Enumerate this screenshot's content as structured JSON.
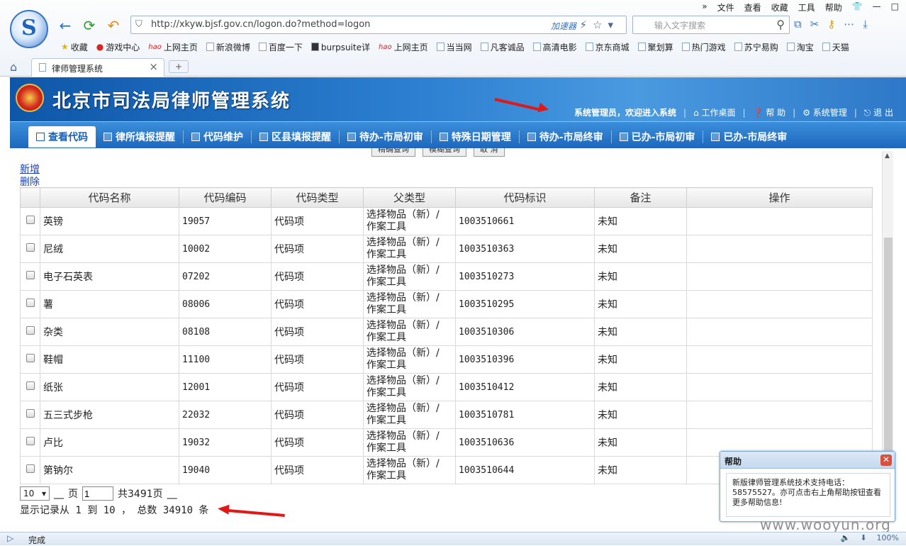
{
  "browser": {
    "menu": [
      "»",
      "文件",
      "查看",
      "收藏",
      "工具",
      "帮助"
    ],
    "url": "http://xkyw.bjsf.gov.cn/logon.do?method=logon",
    "accelerator": "加速器",
    "search_placeholder": "输入文字搜索",
    "bookmarks": [
      "收藏",
      "游戏中心",
      "上网主页",
      "新浪微博",
      "百度一下",
      "burpsuite详",
      "上网主页",
      "当当网",
      "凡客诚品",
      "高清电影",
      "京东商城",
      "聚划算",
      "热门游戏",
      "苏宁易购",
      "淘宝",
      "天猫"
    ],
    "tab_title": "律师管理系统",
    "status_text": "完成",
    "zoom": "100%"
  },
  "app": {
    "title": "北京市司法局律师管理系统",
    "welcome": "系统管理员，欢迎进入系统",
    "top_links": [
      "工作桌面",
      "帮 助",
      "系统管理",
      "退 出"
    ],
    "nav": [
      "查看代码",
      "律所填报提醒",
      "代码维护",
      "区县填报提醒",
      "待办-市局初审",
      "特殊日期管理",
      "待办-市局终审",
      "已办-市局初审",
      "已办-市局终审"
    ],
    "top_buttons": [
      "精确查询",
      "模糊查询",
      "取 消"
    ],
    "add_link": "新增",
    "delete_link": "删除",
    "columns": [
      "代码名称",
      "代码编码",
      "代码类型",
      "父类型",
      "代码标识",
      "备注",
      "操作"
    ],
    "rows": [
      {
        "name": "英镑",
        "code": "19057",
        "type": "代码项",
        "parent1": "选择物品（新）/",
        "parent2": "作案工具",
        "id": "1003510661",
        "note": "未知"
      },
      {
        "name": "尼绒",
        "code": "10002",
        "type": "代码项",
        "parent1": "选择物品（新）/",
        "parent2": "作案工具",
        "id": "1003510363",
        "note": "未知"
      },
      {
        "name": "电子石英表",
        "code": "07202",
        "type": "代码项",
        "parent1": "选择物品（新）/",
        "parent2": "作案工具",
        "id": "1003510273",
        "note": "未知"
      },
      {
        "name": "薯",
        "code": "08006",
        "type": "代码项",
        "parent1": "选择物品（新）/",
        "parent2": "作案工具",
        "id": "1003510295",
        "note": "未知"
      },
      {
        "name": "杂类",
        "code": "08108",
        "type": "代码项",
        "parent1": "选择物品（新）/",
        "parent2": "作案工具",
        "id": "1003510306",
        "note": "未知"
      },
      {
        "name": "鞋帽",
        "code": "11100",
        "type": "代码项",
        "parent1": "选择物品（新）/",
        "parent2": "作案工具",
        "id": "1003510396",
        "note": "未知"
      },
      {
        "name": "纸张",
        "code": "12001",
        "type": "代码项",
        "parent1": "选择物品（新）/",
        "parent2": "作案工具",
        "id": "1003510412",
        "note": "未知"
      },
      {
        "name": "五三式步枪",
        "code": "22032",
        "type": "代码项",
        "parent1": "选择物品（新）/",
        "parent2": "作案工具",
        "id": "1003510781",
        "note": "未知"
      },
      {
        "name": "卢比",
        "code": "19032",
        "type": "代码项",
        "parent1": "选择物品（新）/",
        "parent2": "作案工具",
        "id": "1003510636",
        "note": "未知"
      },
      {
        "name": "第钠尔",
        "code": "19040",
        "type": "代码项",
        "parent1": "选择物品（新）/",
        "parent2": "作案工具",
        "id": "1003510644",
        "note": "未知"
      }
    ],
    "pager": {
      "page_size": "10",
      "blank1": "__",
      "page_label": "页",
      "page_value": "1",
      "total_pages": "共3491页",
      "blank2": "__",
      "record_info": "显示记录从 1 到 10 ， 总数 34910 条"
    },
    "help": {
      "title": "帮助",
      "text": "新版律师管理系统技术支持电话：58575527。亦可点击右上角帮助按钮查看更多帮助信息!"
    }
  },
  "watermark": "www.wooyun.org"
}
